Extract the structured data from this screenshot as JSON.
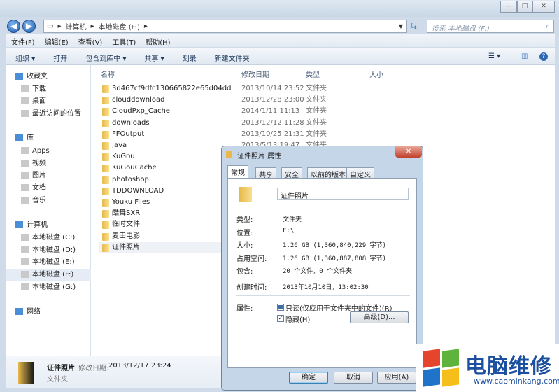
{
  "window": {
    "min": "—",
    "max": "□",
    "close": "✕"
  },
  "address": {
    "path": [
      "计算机",
      "本地磁盘 (F:)"
    ],
    "search_placeholder": "搜索 本地磁盘 (F:)"
  },
  "menu": [
    "文件(F)",
    "编辑(E)",
    "查看(V)",
    "工具(T)",
    "帮助(H)"
  ],
  "toolbar": [
    "组织 ▾",
    "打开",
    "包含到库中 ▾",
    "共享 ▾",
    "刻录",
    "新建文件夹"
  ],
  "sidebar": [
    {
      "label": "收藏夹",
      "top": true
    },
    {
      "label": "下载"
    },
    {
      "label": "桌面"
    },
    {
      "label": "最近访问的位置"
    },
    {
      "label": "库",
      "top": true
    },
    {
      "label": "Apps"
    },
    {
      "label": "视频"
    },
    {
      "label": "图片"
    },
    {
      "label": "文档"
    },
    {
      "label": "音乐"
    },
    {
      "label": "计算机",
      "top": true
    },
    {
      "label": "本地磁盘 (C:)"
    },
    {
      "label": "本地磁盘 (D:)"
    },
    {
      "label": "本地磁盘 (E:)"
    },
    {
      "label": "本地磁盘 (F:)",
      "selected": true
    },
    {
      "label": "本地磁盘 (G:)"
    },
    {
      "label": "网络",
      "top": true
    }
  ],
  "columns": {
    "name": "名称",
    "date": "修改日期",
    "type": "类型",
    "size": "大小"
  },
  "files": [
    {
      "name": "3d467cf9dfc130665822e65d04dd",
      "date": "2013/10/14 23:52",
      "type": "文件夹"
    },
    {
      "name": "clouddownload",
      "date": "2013/12/28 23:00",
      "type": "文件夹"
    },
    {
      "name": "CloudPxp_Cache",
      "date": "2014/1/11 11:13",
      "type": "文件夹"
    },
    {
      "name": "downloads",
      "date": "2013/12/12 11:28",
      "type": "文件夹"
    },
    {
      "name": "FFOutput",
      "date": "2013/10/25 21:31",
      "type": "文件夹"
    },
    {
      "name": "Java",
      "date": "2013/5/13 19:47",
      "type": "文件夹"
    },
    {
      "name": "KuGou"
    },
    {
      "name": "KuGouCache"
    },
    {
      "name": "photoshop"
    },
    {
      "name": "TDDOWNLOAD"
    },
    {
      "name": "Youku Files"
    },
    {
      "name": "酷舞SXR"
    },
    {
      "name": "临时文件"
    },
    {
      "name": "麦田电影"
    },
    {
      "name": "证件照片",
      "selected": true
    }
  ],
  "details": {
    "name": "证件照片",
    "modified_label": "修改日期:",
    "modified": "2013/12/17 23:24",
    "type": "文件夹"
  },
  "dialog": {
    "title": "证件照片 属性",
    "close": "✕",
    "tabs": [
      "常规",
      "共享",
      "安全",
      "以前的版本",
      "自定义"
    ],
    "folder_name": "证件照片",
    "fields": [
      {
        "label": "类型:",
        "value": "文件夹"
      },
      {
        "label": "位置:",
        "value": "F:\\"
      },
      {
        "label": "大小:",
        "value": "1.26 GB (1,360,840,229 字节)"
      },
      {
        "label": "占用空间:",
        "value": "1.26 GB (1,360,887,808 字节)"
      },
      {
        "label": "包含:",
        "value": "20 个文件，0 个文件夹"
      }
    ],
    "created_label": "创建时间:",
    "created": "2013年10月10日，13:02:30",
    "attr_label": "属性:",
    "readonly": "只读(仅应用于文件夹中的文件)(R)",
    "hidden": "隐藏(H)",
    "advanced": "高级(D)...",
    "ok": "确定",
    "cancel": "取消",
    "apply": "应用(A)"
  },
  "watermark": {
    "title": "电脑维修",
    "url": "www.caominkang.com"
  }
}
